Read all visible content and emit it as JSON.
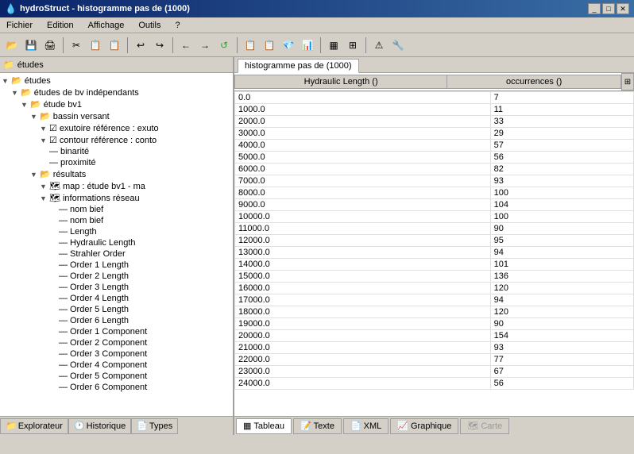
{
  "window": {
    "title": "hydroStruct - histogramme pas de (1000)",
    "controls": [
      "_",
      "□",
      "✕"
    ]
  },
  "menubar": {
    "items": [
      "Fichier",
      "Edition",
      "Affichage",
      "Outils",
      "?"
    ]
  },
  "toolbar": {
    "buttons": [
      "📂",
      "💾",
      "🖨",
      "✂",
      "📋",
      "📋",
      "↩",
      "↪",
      "←",
      "→",
      "🔄",
      "📋",
      "📋",
      "💎",
      "📊",
      "▦",
      "⊞",
      "⚠",
      "🔧"
    ]
  },
  "leftPanel": {
    "header": "études",
    "tree": [
      {
        "level": 0,
        "expanded": true,
        "label": "études",
        "type": "folder"
      },
      {
        "level": 1,
        "expanded": true,
        "label": "études de bv indépendants",
        "type": "folder"
      },
      {
        "level": 2,
        "expanded": true,
        "label": "étude bv1",
        "type": "folder"
      },
      {
        "level": 3,
        "expanded": true,
        "label": "bassin versant",
        "type": "folder"
      },
      {
        "level": 4,
        "expanded": true,
        "label": "exutoire référence : exuto",
        "type": "check"
      },
      {
        "level": 4,
        "expanded": true,
        "label": "contour référence : conto",
        "type": "check"
      },
      {
        "level": 4,
        "expanded": false,
        "label": "binarité",
        "type": "leaf"
      },
      {
        "level": 4,
        "expanded": false,
        "label": "proximité",
        "type": "leaf"
      },
      {
        "level": 3,
        "expanded": true,
        "label": "résultats",
        "type": "folder"
      },
      {
        "level": 4,
        "expanded": true,
        "label": "map : étude bv1 - ma",
        "type": "map"
      },
      {
        "level": 4,
        "expanded": true,
        "label": "informations réseau",
        "type": "map"
      },
      {
        "level": 5,
        "expanded": false,
        "label": "nom bief",
        "type": "leaf"
      },
      {
        "level": 5,
        "expanded": false,
        "label": "nom bief",
        "type": "leaf"
      },
      {
        "level": 5,
        "expanded": false,
        "label": "Length",
        "type": "leaf"
      },
      {
        "level": 5,
        "expanded": false,
        "label": "Hydraulic Length",
        "type": "leaf"
      },
      {
        "level": 5,
        "expanded": false,
        "label": "Strahler Order",
        "type": "leaf"
      },
      {
        "level": 5,
        "expanded": false,
        "label": "Order 1 Length",
        "type": "leaf"
      },
      {
        "level": 5,
        "expanded": false,
        "label": "Order 2 Length",
        "type": "leaf"
      },
      {
        "level": 5,
        "expanded": false,
        "label": "Order 3 Length",
        "type": "leaf"
      },
      {
        "level": 5,
        "expanded": false,
        "label": "Order 4 Length",
        "type": "leaf"
      },
      {
        "level": 5,
        "expanded": false,
        "label": "Order 5 Length",
        "type": "leaf"
      },
      {
        "level": 5,
        "expanded": false,
        "label": "Order 6 Length",
        "type": "leaf"
      },
      {
        "level": 5,
        "expanded": false,
        "label": "Order 1 Component",
        "type": "leaf"
      },
      {
        "level": 5,
        "expanded": false,
        "label": "Order 2 Component",
        "type": "leaf"
      },
      {
        "level": 5,
        "expanded": false,
        "label": "Order 3 Component",
        "type": "leaf"
      },
      {
        "level": 5,
        "expanded": false,
        "label": "Order 4 Component",
        "type": "leaf"
      },
      {
        "level": 5,
        "expanded": false,
        "label": "Order 5 Component",
        "type": "leaf"
      },
      {
        "level": 5,
        "expanded": false,
        "label": "Order 6 Component",
        "type": "leaf"
      }
    ],
    "bottomTabs": [
      "Explorateur",
      "Historique",
      "Types"
    ]
  },
  "rightPanel": {
    "activeTab": "histogramme pas de (1000)",
    "tabs": [
      "histogramme pas de (1000)"
    ],
    "table": {
      "columns": [
        "Hydraulic Length ()",
        "occurrences ()"
      ],
      "rows": [
        [
          "0.0",
          "7"
        ],
        [
          "1000.0",
          "11"
        ],
        [
          "2000.0",
          "33"
        ],
        [
          "3000.0",
          "29"
        ],
        [
          "4000.0",
          "57"
        ],
        [
          "5000.0",
          "56"
        ],
        [
          "6000.0",
          "82"
        ],
        [
          "7000.0",
          "93"
        ],
        [
          "8000.0",
          "100"
        ],
        [
          "9000.0",
          "104"
        ],
        [
          "10000.0",
          "100"
        ],
        [
          "11000.0",
          "90"
        ],
        [
          "12000.0",
          "95"
        ],
        [
          "13000.0",
          "94"
        ],
        [
          "14000.0",
          "101"
        ],
        [
          "15000.0",
          "136"
        ],
        [
          "16000.0",
          "120"
        ],
        [
          "17000.0",
          "94"
        ],
        [
          "18000.0",
          "120"
        ],
        [
          "19000.0",
          "90"
        ],
        [
          "20000.0",
          "154"
        ],
        [
          "21000.0",
          "93"
        ],
        [
          "22000.0",
          "77"
        ],
        [
          "23000.0",
          "67"
        ],
        [
          "24000.0",
          "56"
        ]
      ]
    },
    "bottomTabs": [
      "Tableau",
      "Texte",
      "XML",
      "Graphique",
      "Carte"
    ],
    "activeBottomTab": "Tableau"
  }
}
